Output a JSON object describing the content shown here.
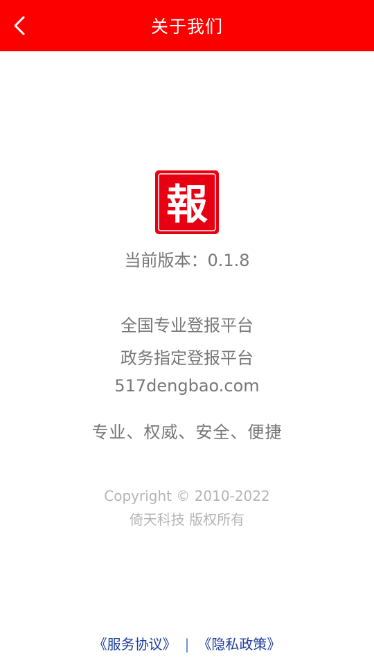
{
  "header": {
    "title": "关于我们",
    "back_icon": "chevron-left-icon",
    "background_color": "#fc0000"
  },
  "logo": {
    "glyph": "報",
    "color": "#e60012"
  },
  "version": {
    "text": "当前版本：0.1.8"
  },
  "taglines": [
    "全国专业登报平台",
    "政务指定登报平台",
    "517dengbao.com"
  ],
  "motto": "专业、权威、安全、便捷",
  "copyright": {
    "line1": "Copyright © 2010-2022",
    "line2": "倚天科技 版权所有"
  },
  "footer": {
    "service_agreement": "《服务协议》",
    "separator": "|",
    "privacy_policy": "《隐私政策》"
  }
}
